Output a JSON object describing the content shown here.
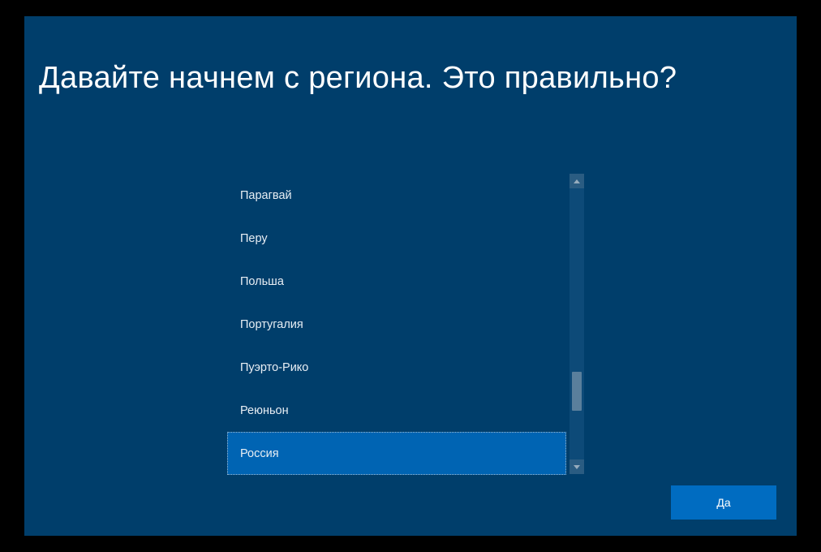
{
  "heading": "Давайте начнем с региона. Это правильно?",
  "regions": [
    {
      "label": "Парагвай",
      "selected": false
    },
    {
      "label": "Перу",
      "selected": false
    },
    {
      "label": "Польша",
      "selected": false
    },
    {
      "label": "Португалия",
      "selected": false
    },
    {
      "label": "Пуэрто-Рико",
      "selected": false
    },
    {
      "label": "Реюньон",
      "selected": false
    },
    {
      "label": "Россия",
      "selected": true
    }
  ],
  "confirm_button": "Да"
}
